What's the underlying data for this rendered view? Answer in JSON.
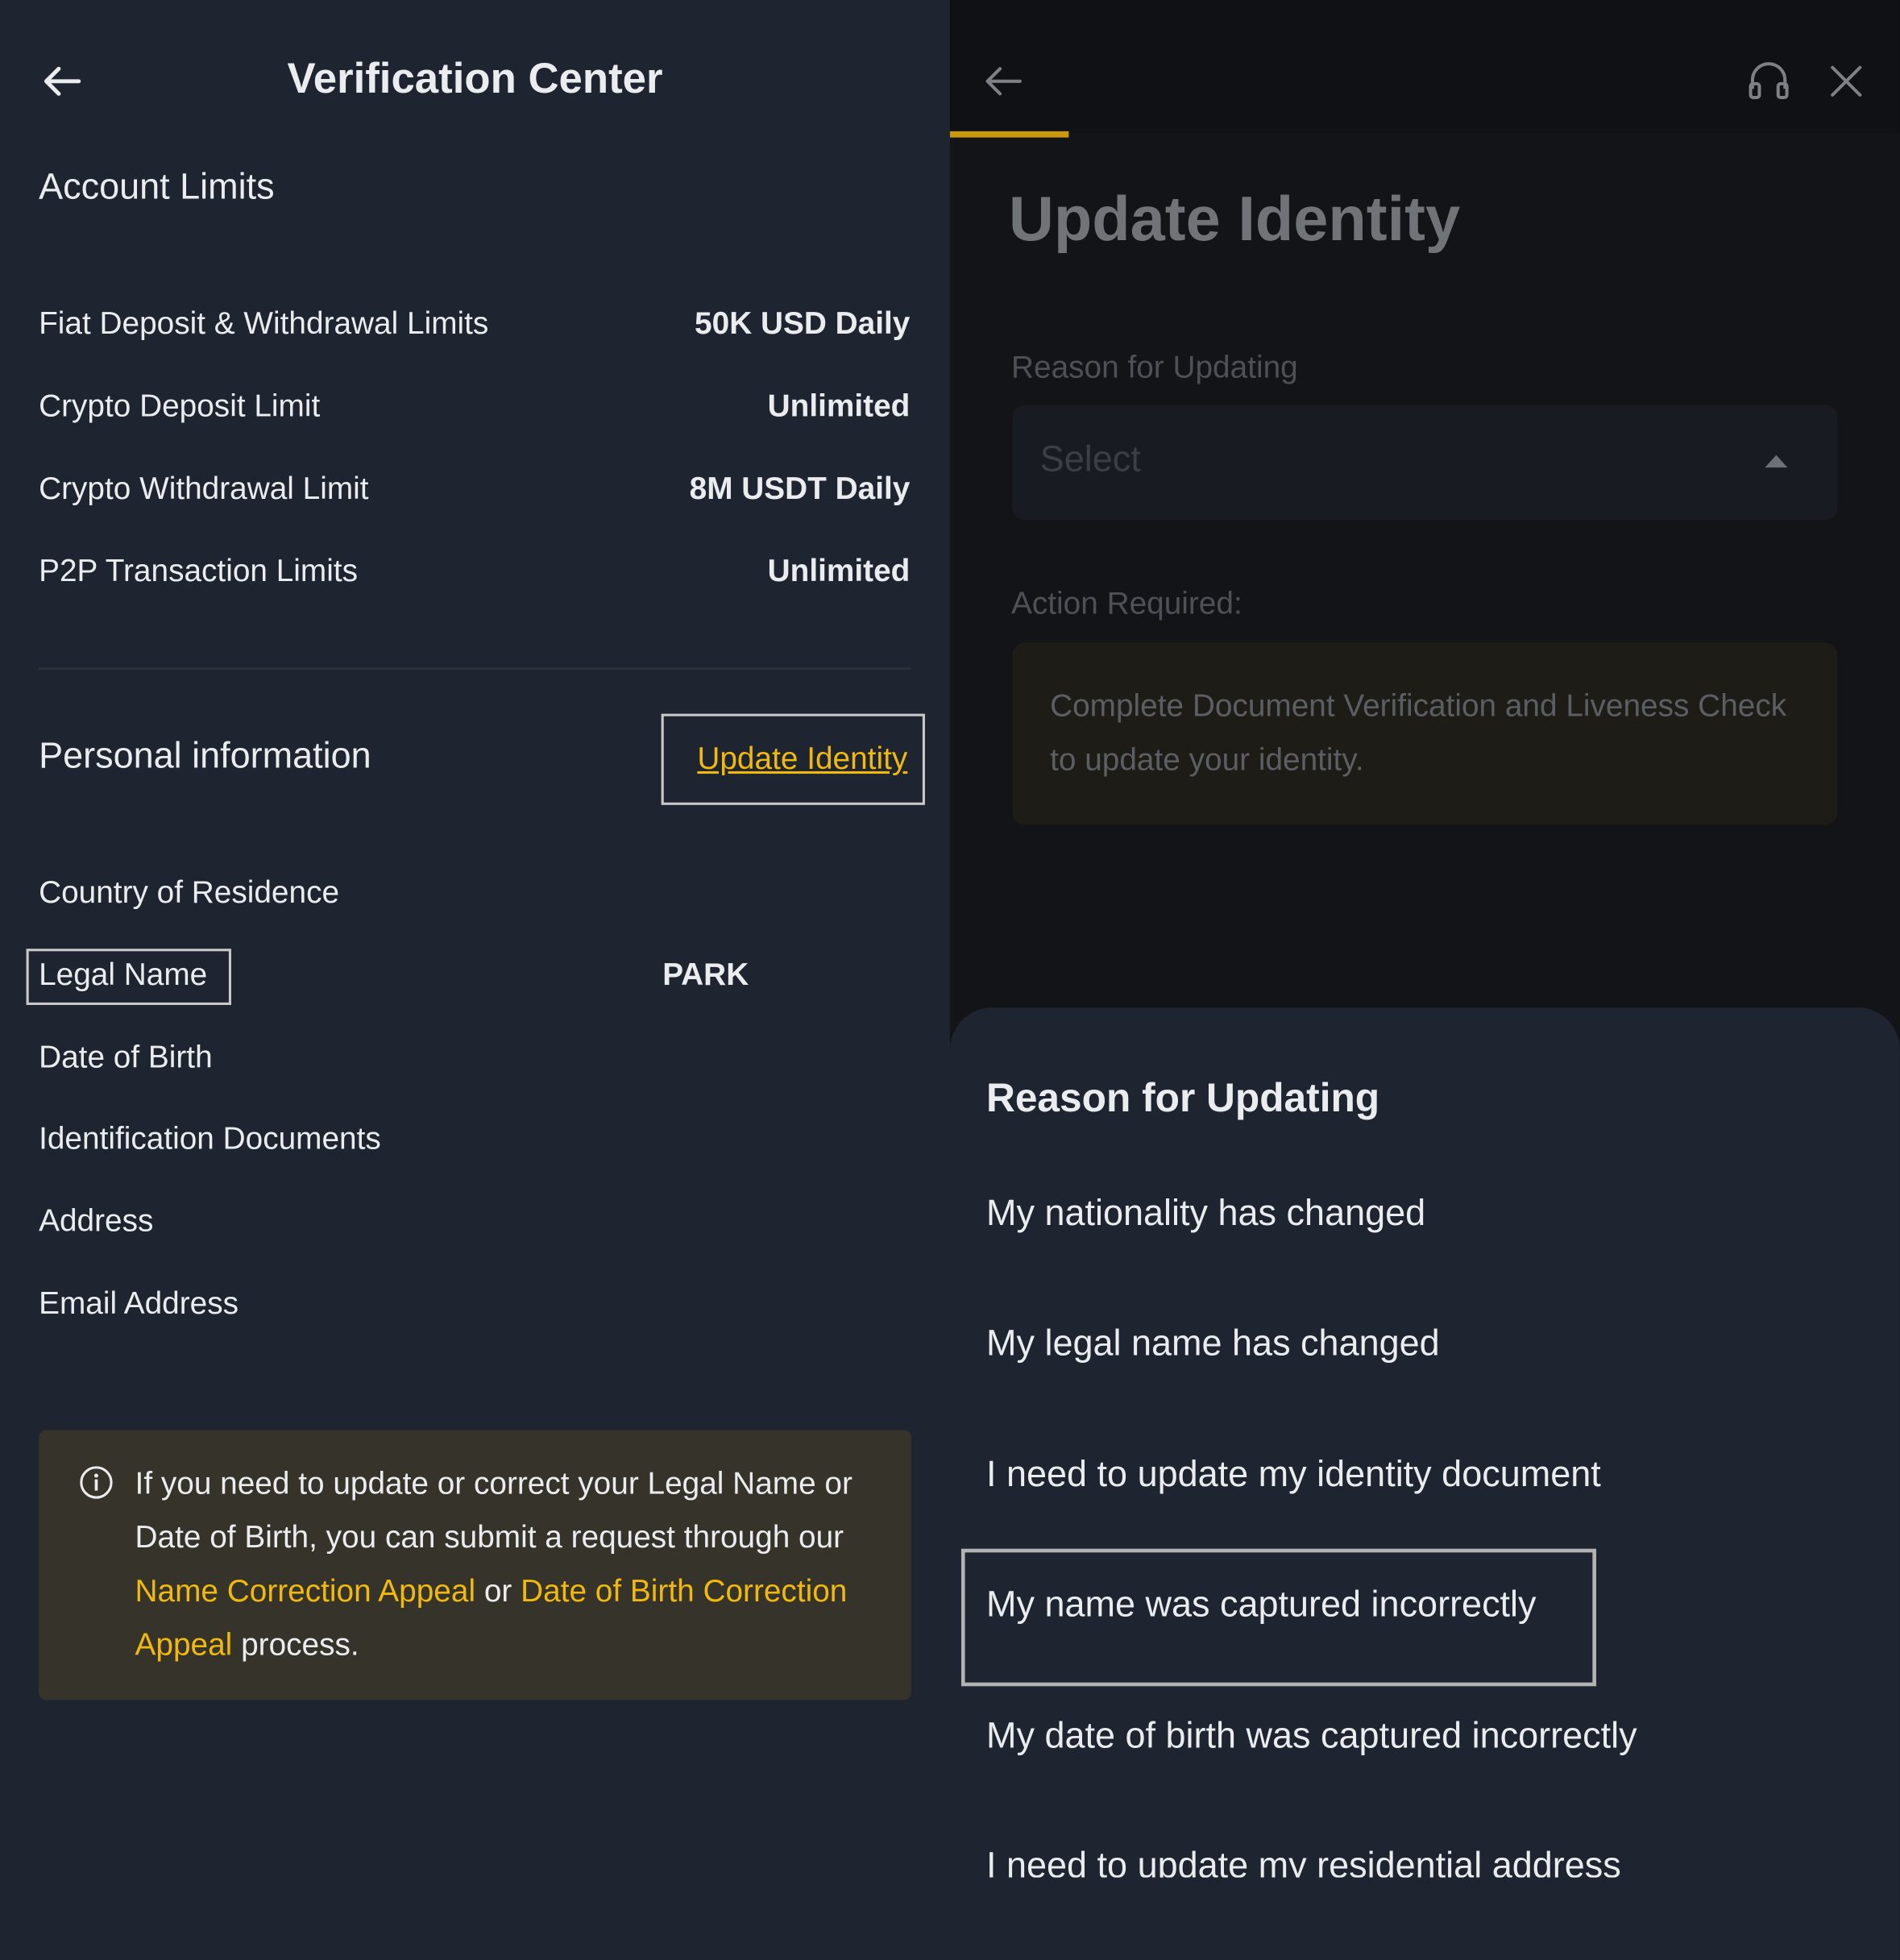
{
  "left": {
    "title": "Verification Center",
    "account_limits": {
      "title": "Account Limits",
      "rows": [
        {
          "label": "Fiat Deposit & Withdrawal Limits",
          "value": "50K USD Daily"
        },
        {
          "label": "Crypto Deposit Limit",
          "value": "Unlimited"
        },
        {
          "label": "Crypto Withdrawal Limit",
          "value": "8M USDT Daily"
        },
        {
          "label": "P2P Transaction Limits",
          "value": "Unlimited"
        }
      ]
    },
    "personal_info": {
      "title": "Personal information",
      "update_link": "Update Identity",
      "rows": [
        {
          "label": "Country of Residence",
          "value": ""
        },
        {
          "label": "Legal Name",
          "value": "PARK"
        },
        {
          "label": "Date of Birth",
          "value": ""
        },
        {
          "label": "Identification Documents",
          "value": ""
        },
        {
          "label": "Address",
          "value": ""
        },
        {
          "label": "Email Address",
          "value": ""
        }
      ]
    },
    "notice": {
      "text_1": "If you need to update or correct your Legal Name or Date of Birth, you can submit a request through our ",
      "link_1": "Name Correction Appeal",
      "text_2": " or ",
      "link_2": "Date of Birth Correction Appeal",
      "text_3": " process."
    }
  },
  "right": {
    "title": "Update Identity",
    "reason_label": "Reason for Updating",
    "select_placeholder": "Select",
    "action_label": "Action Required:",
    "action_text": "Complete Document Verification and Liveness Check to update your identity.",
    "progress": 0.125,
    "sheet": {
      "title": "Reason for Updating",
      "options": [
        "My nationality has changed",
        "My legal name has changed",
        "I need to update my identity document",
        "My name was captured incorrectly",
        "My date of birth was captured incorrectly",
        "I need to update my residential address"
      ]
    }
  },
  "colors": {
    "background": "#1e2430",
    "accent": "#f0b90b",
    "text": "#eaecef",
    "notice_bg": "#36332a"
  }
}
